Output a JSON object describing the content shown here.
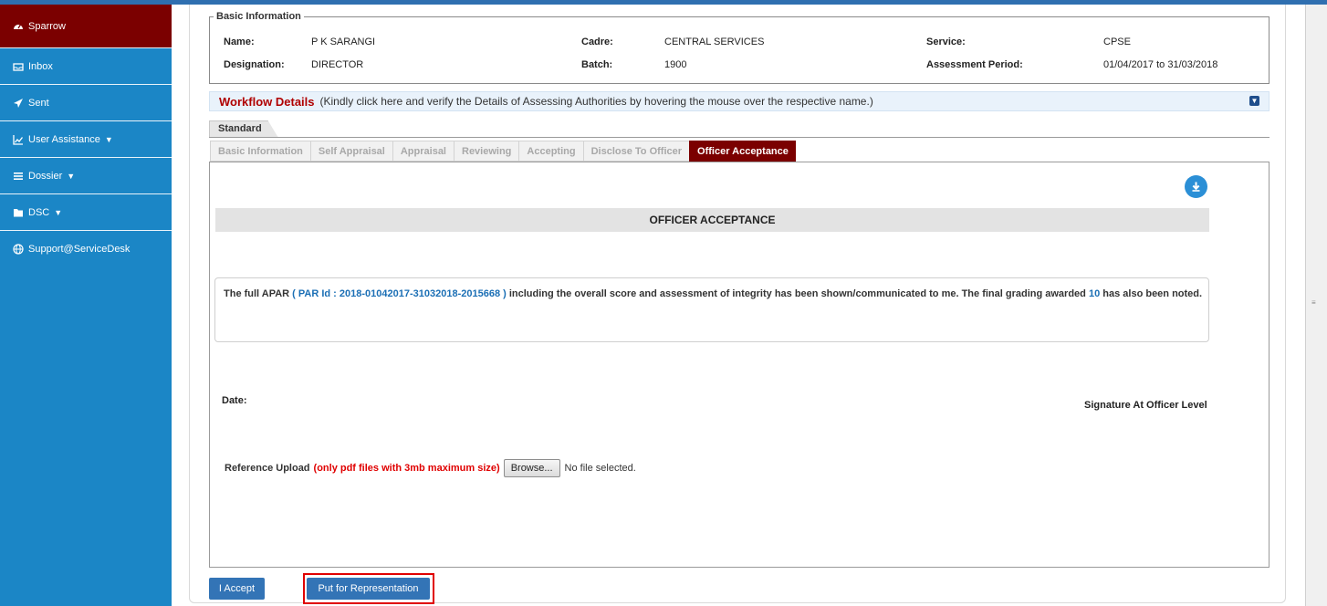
{
  "sidebar": {
    "items": [
      {
        "label": "Sparrow",
        "icon": "dashboard-icon"
      },
      {
        "label": "Inbox",
        "icon": "inbox-icon"
      },
      {
        "label": "Sent",
        "icon": "send-icon"
      },
      {
        "label": "User Assistance",
        "icon": "chart-line-icon"
      },
      {
        "label": "Dossier",
        "icon": "list-icon"
      },
      {
        "label": "DSC",
        "icon": "folder-icon"
      },
      {
        "label": "Support@ServiceDesk",
        "icon": "globe-icon"
      }
    ]
  },
  "basic_info": {
    "legend": "Basic Information",
    "name_label": "Name:",
    "name_value": "P K SARANGI",
    "cadre_label": "Cadre:",
    "cadre_value": "CENTRAL SERVICES",
    "service_label": "Service:",
    "service_value": "CPSE",
    "designation_label": "Designation:",
    "designation_value": "DIRECTOR",
    "batch_label": "Batch:",
    "batch_value": "1900",
    "period_label": "Assessment Period:",
    "period_value": "01/04/2017 to 31/03/2018"
  },
  "workflow": {
    "title": "Workflow Details",
    "description": "(Kindly click here and verify the Details of Assessing Authorities by hovering the mouse over the respective name.)"
  },
  "standard_tab": "Standard",
  "tabs": [
    "Basic Information",
    "Self Appraisal",
    "Appraisal",
    "Reviewing",
    "Accepting",
    "Disclose To Officer",
    "Officer Acceptance"
  ],
  "active_tab": "Officer Acceptance",
  "section_title": "OFFICER ACCEPTANCE",
  "statement": {
    "before": "The full APAR",
    "par_id": "( PAR Id : 2018-01042017-31032018-2015668 )",
    "middle": "including the overall score and assessment of integrity has been shown/communicated to me. The final grading awarded",
    "grade": "10",
    "after": "has also been noted."
  },
  "date_label": "Date:",
  "signature_label": "Signature At Officer Level",
  "reference": {
    "label": "Reference Upload",
    "note": "(only pdf files with 3mb maximum size)",
    "browse_label": "Browse...",
    "file_status": "No file selected."
  },
  "buttons": {
    "accept": "I Accept",
    "representation": "Put for Representation"
  },
  "colors": {
    "sidebar": "#1b86c6",
    "active": "#7b0000",
    "button": "#3374b6",
    "highlight": "#e00000"
  }
}
